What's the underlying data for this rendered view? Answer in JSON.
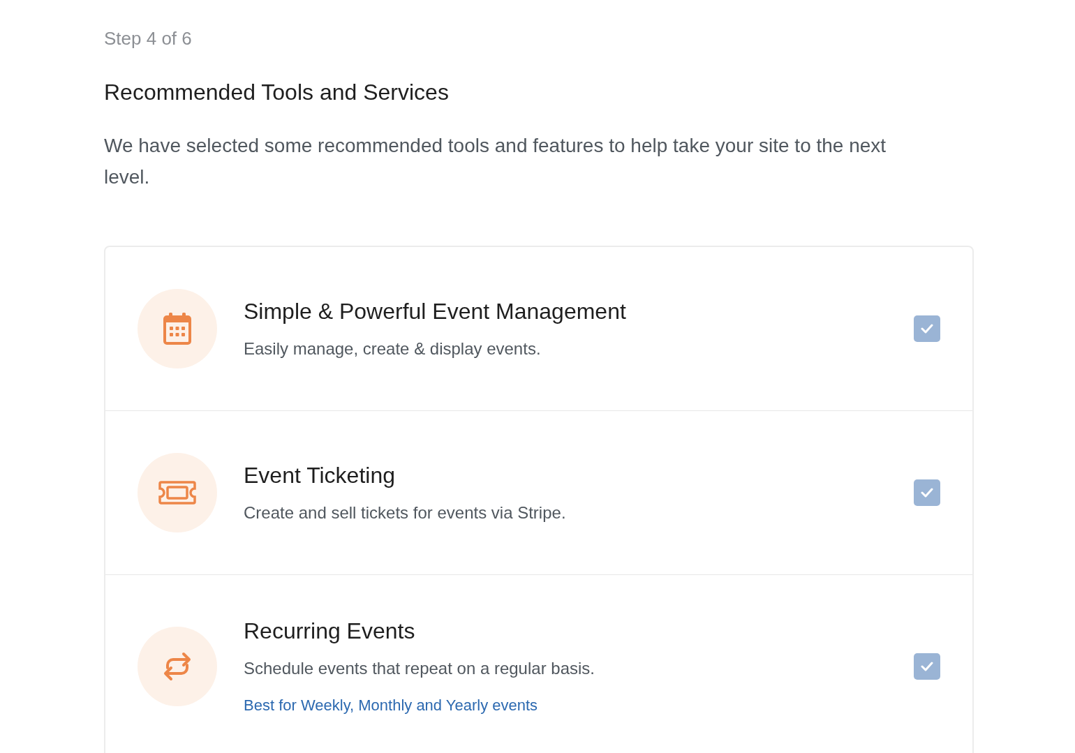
{
  "step": "Step 4 of 6",
  "heading": "Recommended Tools and Services",
  "intro": "We have selected some recommended tools and features to help take your site to the next level.",
  "features": [
    {
      "kind": "calendar",
      "title": "Simple & Powerful Event Management",
      "description": "Easily manage, create & display events.",
      "checked": true
    },
    {
      "kind": "ticket",
      "title": "Event Ticketing",
      "description": "Create and sell tickets for events via Stripe.",
      "checked": true
    },
    {
      "kind": "repeat",
      "title": "Recurring Events",
      "description": "Schedule events that repeat on a regular basis.",
      "note": "Best for Weekly, Monthly and Yearly events",
      "checked": true
    }
  ]
}
